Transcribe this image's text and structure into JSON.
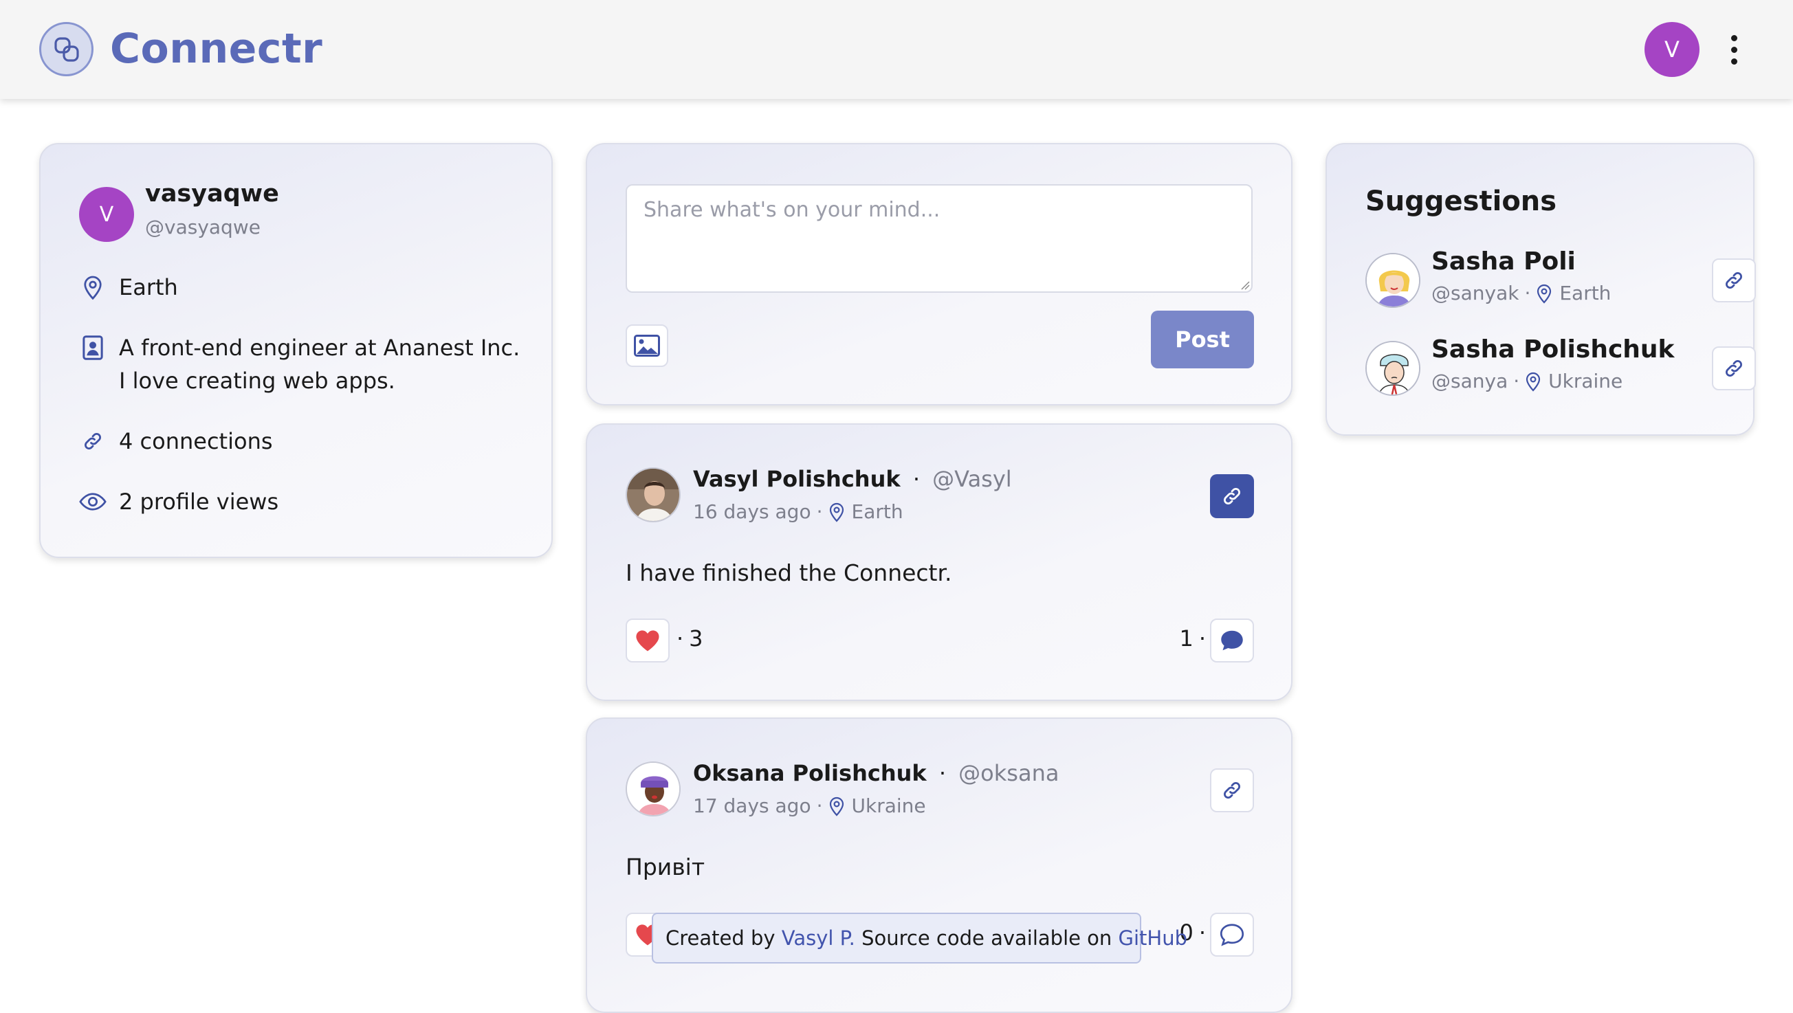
{
  "app": {
    "name": "Connectr",
    "user_initial": "V"
  },
  "profile": {
    "initial": "V",
    "username": "vasyaqwe",
    "handle": "@vasyaqwe",
    "location": "Earth",
    "bio": "A front-end engineer at Ananest Inc. I love creating web apps.",
    "connections": "4 connections",
    "views": "2 profile views"
  },
  "composer": {
    "placeholder": "Share what's on your mind...",
    "post_label": "Post"
  },
  "posts": [
    {
      "author": "Vasyl Polishchuk",
      "handle": "@Vasyl",
      "time": "16 days ago",
      "location": "Earth",
      "body": "I have finished the Connectr.",
      "likes": "3",
      "comments": "1"
    },
    {
      "author": "Oksana Polishchuk",
      "handle": "@oksana",
      "time": "17 days ago",
      "location": "Ukraine",
      "body": "Привіт",
      "comments": "0"
    }
  ],
  "suggestions": {
    "title": "Suggestions",
    "items": [
      {
        "name": "Sasha Poli",
        "handle": "@sanyak",
        "location": "Earth"
      },
      {
        "name": "Sasha Polishchuk",
        "handle": "@sanya",
        "location": "Ukraine"
      }
    ]
  },
  "footer": {
    "created_by": "Created by",
    "author_link": "Vasyl P.",
    "source_text": "Source code available on",
    "github_link": "GitHub"
  },
  "colors": {
    "accent": "#3f52a5",
    "avatar": "#a544c4",
    "post_button": "#7a87c9",
    "like": "#e5484d"
  },
  "icons": [
    "logo-icon",
    "kebab-menu-icon",
    "location-pin-icon",
    "id-card-icon",
    "link-icon",
    "eye-icon",
    "image-icon",
    "heart-icon",
    "comment-icon"
  ]
}
